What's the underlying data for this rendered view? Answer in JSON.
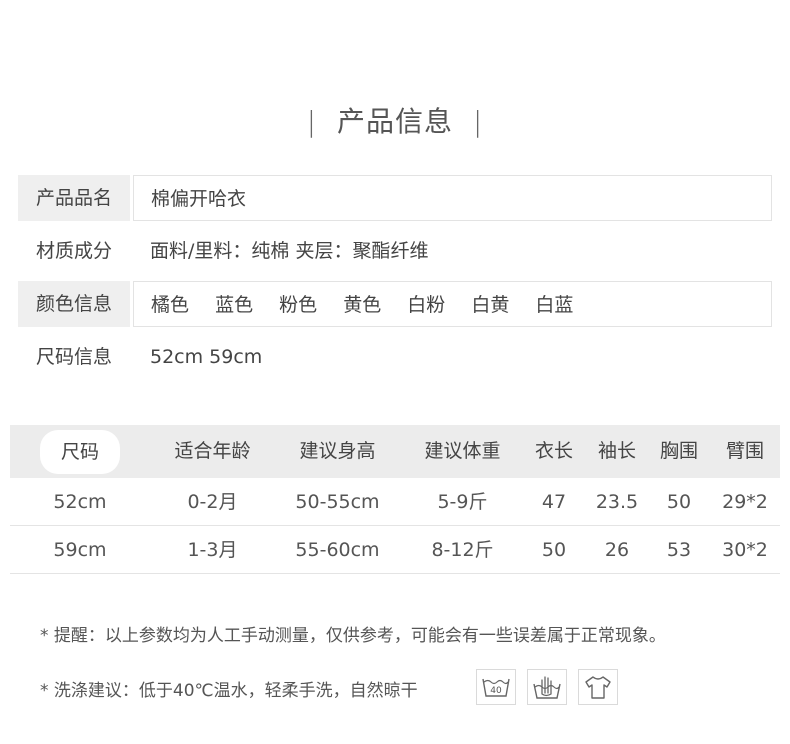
{
  "section_title": "产品信息",
  "title_bar_left": "|",
  "title_bar_right": "|",
  "info": {
    "name_label": "产品品名",
    "name_value": "棉偏开哈衣",
    "material_label": "材质成分",
    "material_value": "面料/里料：纯棉 夹层：聚酯纤维",
    "color_label": "颜色信息",
    "colors": [
      "橘色",
      "蓝色",
      "粉色",
      "黄色",
      "白粉",
      "白黄",
      "白蓝"
    ],
    "size_label": "尺码信息",
    "size_value": "52cm 59cm"
  },
  "size_table": {
    "headers": [
      "尺码",
      "适合年龄",
      "建议身高",
      "建议体重",
      "衣长",
      "袖长",
      "胸围",
      "臂围"
    ],
    "rows": [
      [
        "52cm",
        "0-2月",
        "50-55cm",
        "5-9斤",
        "47",
        "23.5",
        "50",
        "29*2"
      ],
      [
        "59cm",
        "1-3月",
        "55-60cm",
        "8-12斤",
        "50",
        "26",
        "53",
        "30*2"
      ]
    ]
  },
  "notes": {
    "reminder": "* 提醒：以上参数均为人工手动测量，仅供参考，可能会有一些误差属于正常现象。",
    "washing": "* 洗涤建议：低于40℃温水，轻柔手洗，自然晾干"
  },
  "care_icons": [
    {
      "name": "wash-40-icon",
      "label": "40"
    },
    {
      "name": "hand-wash-icon"
    },
    {
      "name": "hang-dry-icon"
    }
  ]
}
